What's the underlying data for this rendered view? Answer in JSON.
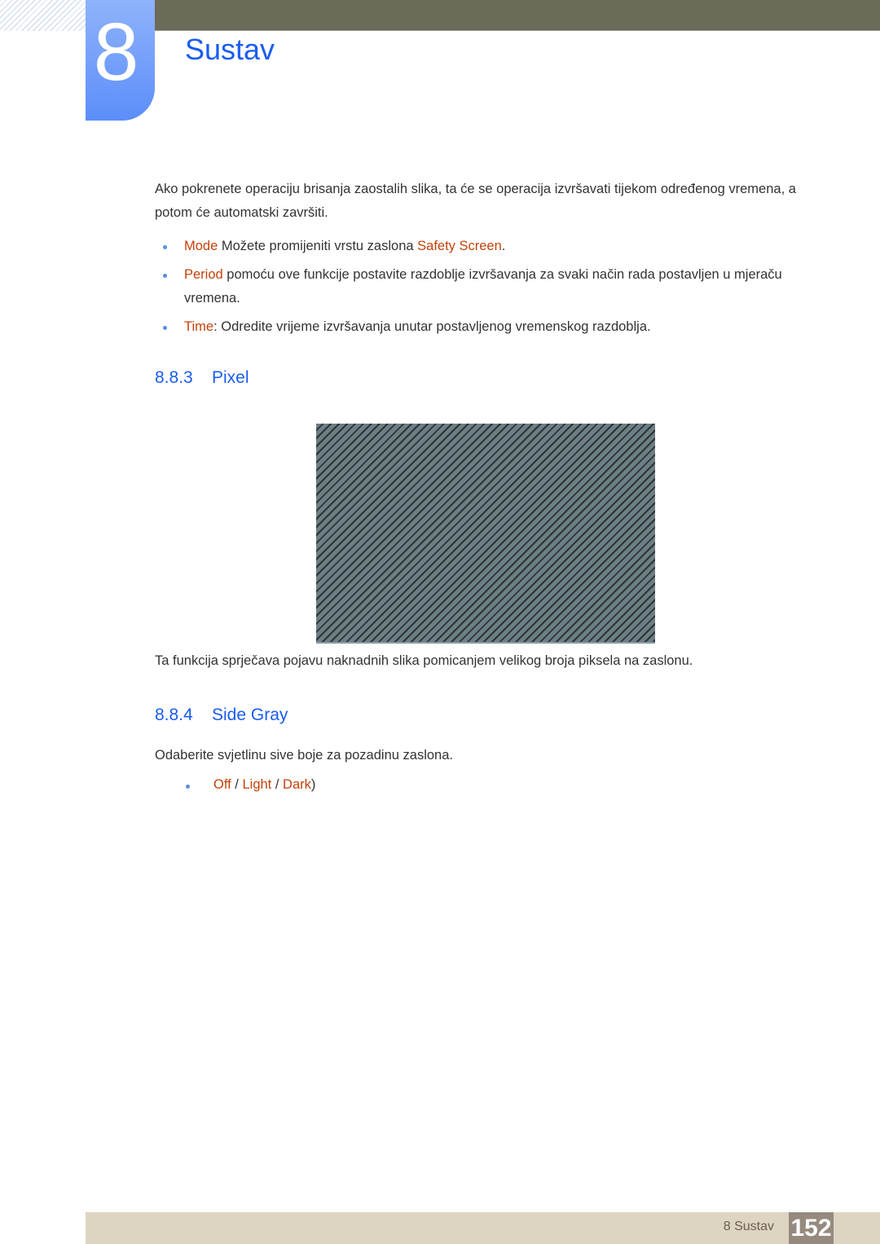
{
  "header": {
    "chapter_number": "8",
    "chapter_title": "Sustav"
  },
  "intro": {
    "text": "Ako pokrenete operaciju brisanja zaostalih slika, ta će se operacija izvršavati tijekom određenog vremena, a potom će automatski završiti.",
    "bullets": [
      {
        "term": "Mode",
        "text_before": " Možete promijeniti vrstu zaslona ",
        "term2": "Safety Screen",
        "text_after": "."
      },
      {
        "term": "Period",
        "text": " pomoću ove funkcije postavite razdoblje izvršavanja za svaki način rada postavljen u mjeraču vremena."
      },
      {
        "term": "Time",
        "text": ": Odredite vrijeme izvršavanja unutar postavljenog vremenskog razdoblja."
      }
    ]
  },
  "section_pixel": {
    "number": "8.8.3",
    "title": "Pixel",
    "image_alt": "pixel-shift-pattern",
    "description": "Ta funkcija sprječava pojavu naknadnih slika pomicanjem velikog broja piksela na zaslonu."
  },
  "section_side_gray": {
    "number": "8.8.4",
    "title": "Side Gray",
    "description": "Odaberite svjetlinu sive boje za pozadinu zaslona.",
    "options": [
      "Off",
      "Light",
      "Dark"
    ],
    "separator": " / ",
    "closing": ")"
  },
  "footer": {
    "label": "8 Sustav",
    "page": "152"
  },
  "colors": {
    "heading_blue": "#1a5cf0",
    "term_orange": "#c4420a",
    "topbar": "#6c6a58",
    "footer_bg": "#ddd5c1",
    "page_box": "#968a7f"
  }
}
